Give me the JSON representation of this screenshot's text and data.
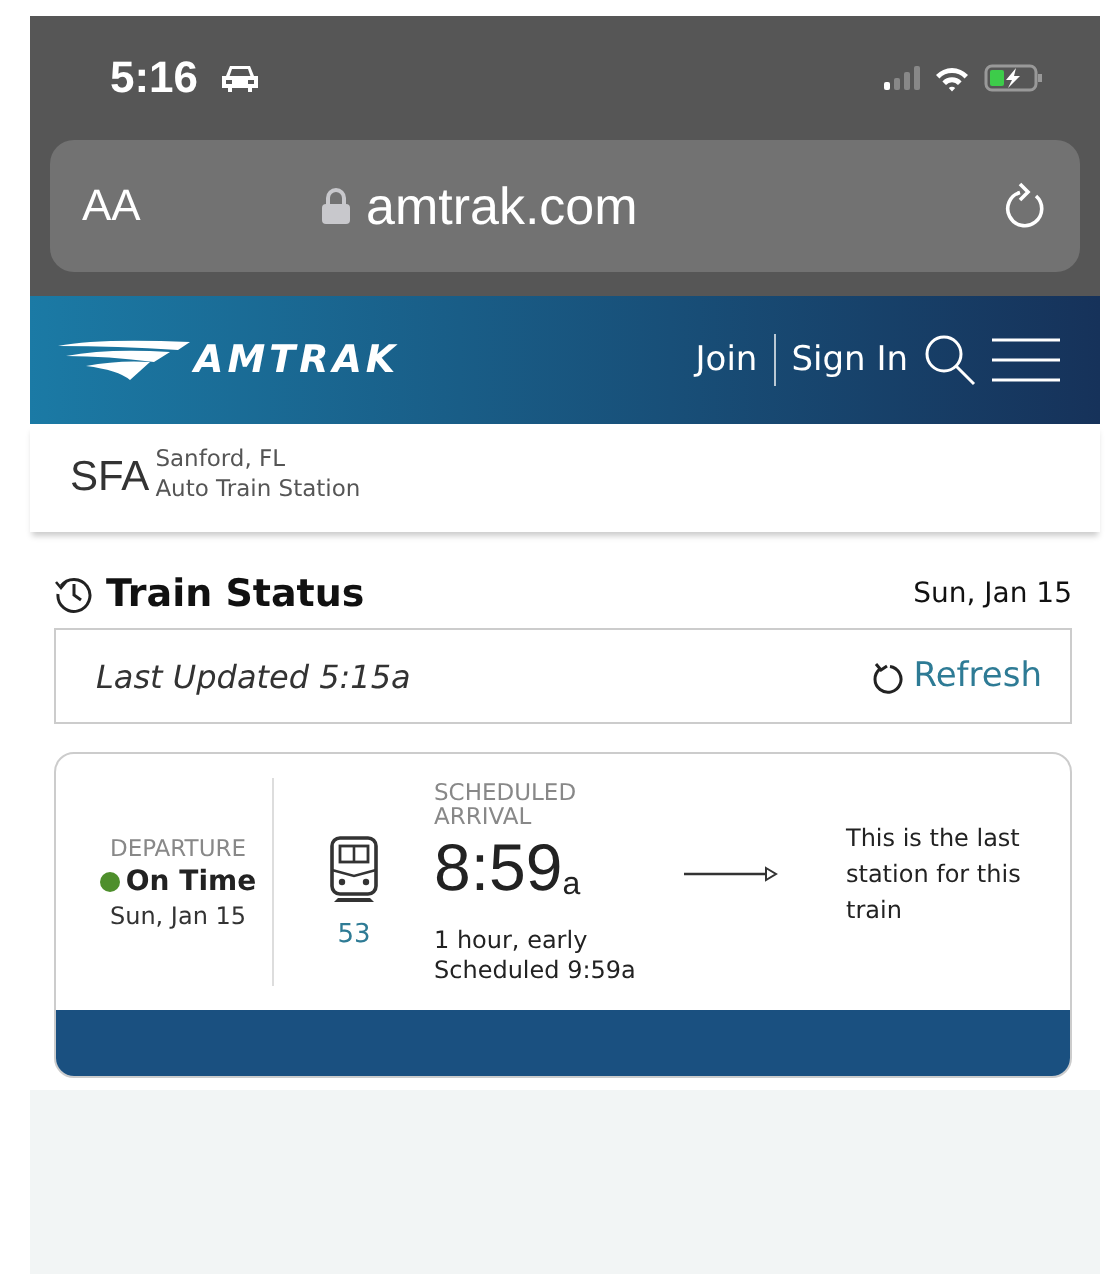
{
  "status_bar": {
    "time": "5:16"
  },
  "browser": {
    "text_size": "AA",
    "url": "amtrak.com"
  },
  "nav": {
    "logo": "AMTRAK",
    "links": [
      "Join",
      "Sign In"
    ]
  },
  "station": {
    "code": "SFA",
    "city": "Sanford, FL",
    "name": "Auto Train Station"
  },
  "train_status": {
    "title": "Train Status",
    "date": "Sun, Jan 15",
    "last_updated": "Last Updated 5:15a",
    "refresh": "Refresh"
  },
  "card": {
    "departure_label": "DEPARTURE",
    "status": "On Time",
    "departure_date": "Sun, Jan 15",
    "train_number": "53",
    "arrival_label": "SCHEDULED ARRIVAL",
    "arrival_time": "8:59$_{a}$",
    "difference": "1 hour, early",
    "scheduled": "Scheduled 9:59a",
    "note": "This is the last station for this train"
  }
}
